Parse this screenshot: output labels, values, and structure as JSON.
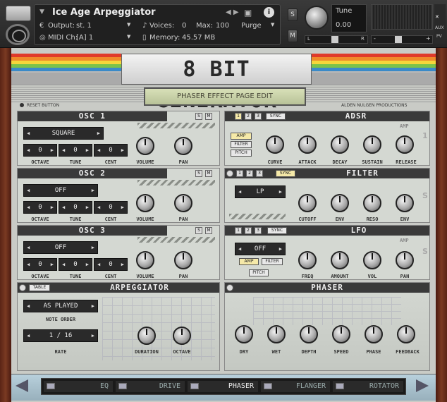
{
  "header": {
    "instrument_name": "Ice Age Arpeggiator",
    "output_label": "Output:",
    "output_value": "st. 1",
    "midi_label": "MIDI Ch:",
    "midi_value": "[A]  1",
    "voices_label": "Voices:",
    "voices_value": "0",
    "max_label": "Max:",
    "max_value": "100",
    "memory_label": "Memory:",
    "memory_value": "45.57 MB",
    "purge_label": "Purge",
    "solo_label": "S",
    "mute_label": "M",
    "tune_label": "Tune",
    "tune_value": "0.00",
    "pan_left": "L",
    "pan_right": "R",
    "aux_label": "AUX",
    "pv_label": "PV",
    "plus": "+",
    "minus": "-"
  },
  "instrument": {
    "logo_text": "8 BIT GENERATOR",
    "lcd_text": "PHASER EFFECT PAGE EDIT",
    "reset_label": "RESET BUTTON",
    "credit": "ALDEN NULGEN PRODUCTIONS"
  },
  "osc": [
    {
      "title": "OSC 1",
      "wave": "SQUARE",
      "octave": "0",
      "tune": "0",
      "cent": "0"
    },
    {
      "title": "OSC 2",
      "wave": "OFF",
      "octave": "0",
      "tune": "0",
      "cent": "0"
    },
    {
      "title": "OSC 3",
      "wave": "OFF",
      "octave": "0",
      "tune": "0",
      "cent": "0"
    }
  ],
  "osc_labels": {
    "octave": "OCTAVE",
    "tune": "TUNE",
    "cent": "CENT",
    "volume": "VOLUME",
    "pan": "PAN",
    "s": "S",
    "m": "M"
  },
  "adsr": {
    "title": "ADSR",
    "sync": "SYNC",
    "amp_tag": "AMP",
    "number": "1",
    "targets": [
      "AMP",
      "FILTER",
      "PITCH"
    ],
    "tabs": [
      "1",
      "2",
      "3"
    ],
    "knobs": [
      "CURVE",
      "ATTACK",
      "DECAY",
      "SUSTAIN",
      "RELEASE"
    ]
  },
  "filter": {
    "title": "FILTER",
    "sync": "SYNC",
    "type": "LP",
    "tabs": [
      "1",
      "2",
      "3"
    ],
    "knobs": [
      "CUTOFF",
      "ENV",
      "RESO",
      "ENV"
    ],
    "side": "S"
  },
  "lfo": {
    "title": "LFO",
    "sync": "SYNC",
    "amp_tag": "AMP",
    "wave": "OFF",
    "targets": [
      "AMP",
      "FILTER",
      "PITCH"
    ],
    "tabs": [
      "1",
      "2",
      "3"
    ],
    "knobs": [
      "FREQ",
      "AMOUNT",
      "VOL",
      "PAN"
    ],
    "side": "S"
  },
  "arp": {
    "title": "ARPEGGIATOR",
    "table": "TABLE",
    "order": "AS PLAYED",
    "order_label": "NOTE ORDER",
    "rate": "1 / 16",
    "rate_label": "RATE",
    "knobs": [
      "DURATION",
      "OCTAVE"
    ]
  },
  "phaser": {
    "title": "PHASER",
    "knobs": [
      "DRY",
      "WET",
      "DEPTH",
      "SPEED",
      "PHASE",
      "FEEDBACK"
    ]
  },
  "fx_tabs": [
    "EQ",
    "DRIVE",
    "PHASER",
    "FLANGER",
    "ROTATOR"
  ],
  "fx_active": "PHASER"
}
